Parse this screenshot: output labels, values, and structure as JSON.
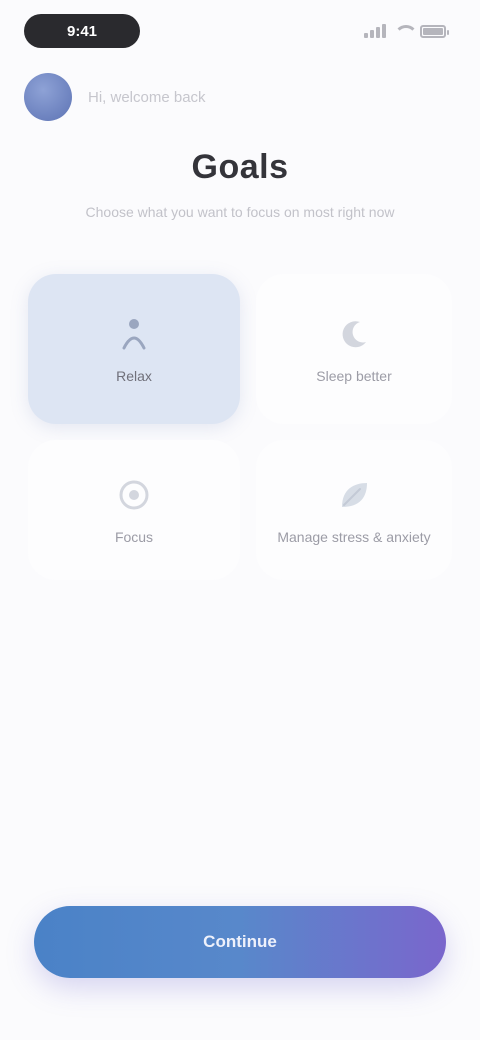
{
  "status_bar": {
    "time": "9:41"
  },
  "user": {
    "name": "Hi, welcome back"
  },
  "heading": {
    "title": "Goals",
    "subtitle": "Choose what you want to focus on most right now"
  },
  "options": [
    {
      "label": "Relax",
      "icon": "person-icon",
      "selected": true
    },
    {
      "label": "Sleep better",
      "icon": "moon-icon",
      "selected": false
    },
    {
      "label": "Focus",
      "icon": "target-icon",
      "selected": false
    },
    {
      "label": "Manage stress & anxiety",
      "icon": "leaf-icon",
      "selected": false
    }
  ],
  "actions": {
    "continue_label": "Continue"
  },
  "colors": {
    "selected_card": "#dde5f3",
    "button_gradient_start": "#4a82c7",
    "button_gradient_end": "#7a66cc",
    "avatar": "#6f84c3"
  }
}
